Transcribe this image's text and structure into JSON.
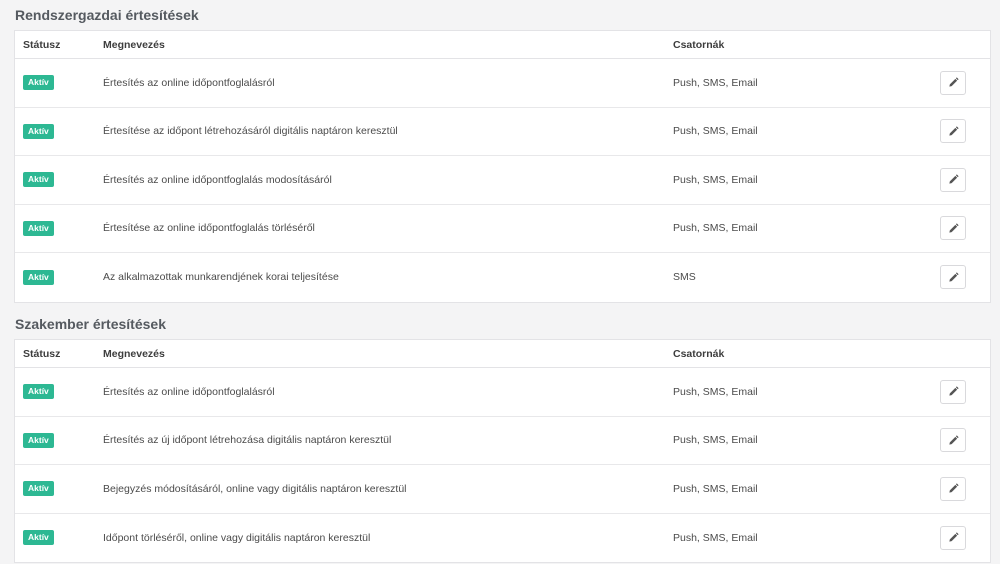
{
  "sections": [
    {
      "title": "Rendszergazdai értesítések",
      "columns": {
        "status": "Státusz",
        "name": "Megnevezés",
        "channels": "Csatornák"
      },
      "rows": [
        {
          "status": "Aktív",
          "name": "Értesítés az online időpontfoglalásról",
          "channels": "Push, SMS, Email"
        },
        {
          "status": "Aktív",
          "name": "Értesítése az időpont létrehozásáról digitális naptáron keresztül",
          "channels": "Push, SMS, Email"
        },
        {
          "status": "Aktív",
          "name": "Értesítés az online időpontfoglalás modosításáról",
          "channels": "Push, SMS, Email"
        },
        {
          "status": "Aktív",
          "name": "Értesítése az online időpontfoglalás törléséről",
          "channels": "Push, SMS, Email"
        },
        {
          "status": "Aktív",
          "name": "Az alkalmazottak munkarendjének korai teljesítése",
          "channels": "SMS"
        }
      ]
    },
    {
      "title": "Szakember értesítések",
      "columns": {
        "status": "Státusz",
        "name": "Megnevezés",
        "channels": "Csatornák"
      },
      "rows": [
        {
          "status": "Aktív",
          "name": "Értesítés az online időpontfoglalásról",
          "channels": "Push, SMS, Email"
        },
        {
          "status": "Aktív",
          "name": "Értesítés az új időpont létrehozása digitális naptáron keresztül",
          "channels": "Push, SMS, Email"
        },
        {
          "status": "Aktív",
          "name": "Bejegyzés módosításáról, online vagy digitális naptáron keresztül",
          "channels": "Push, SMS, Email"
        },
        {
          "status": "Aktív",
          "name": "Időpont törléséről, online vagy digitális naptáron keresztül",
          "channels": "Push, SMS, Email"
        }
      ]
    }
  ],
  "colors": {
    "badge": "#2db893",
    "background": "#f4f4f5",
    "panel": "#ffffff"
  },
  "icons": {
    "edit": "pencil-icon"
  }
}
